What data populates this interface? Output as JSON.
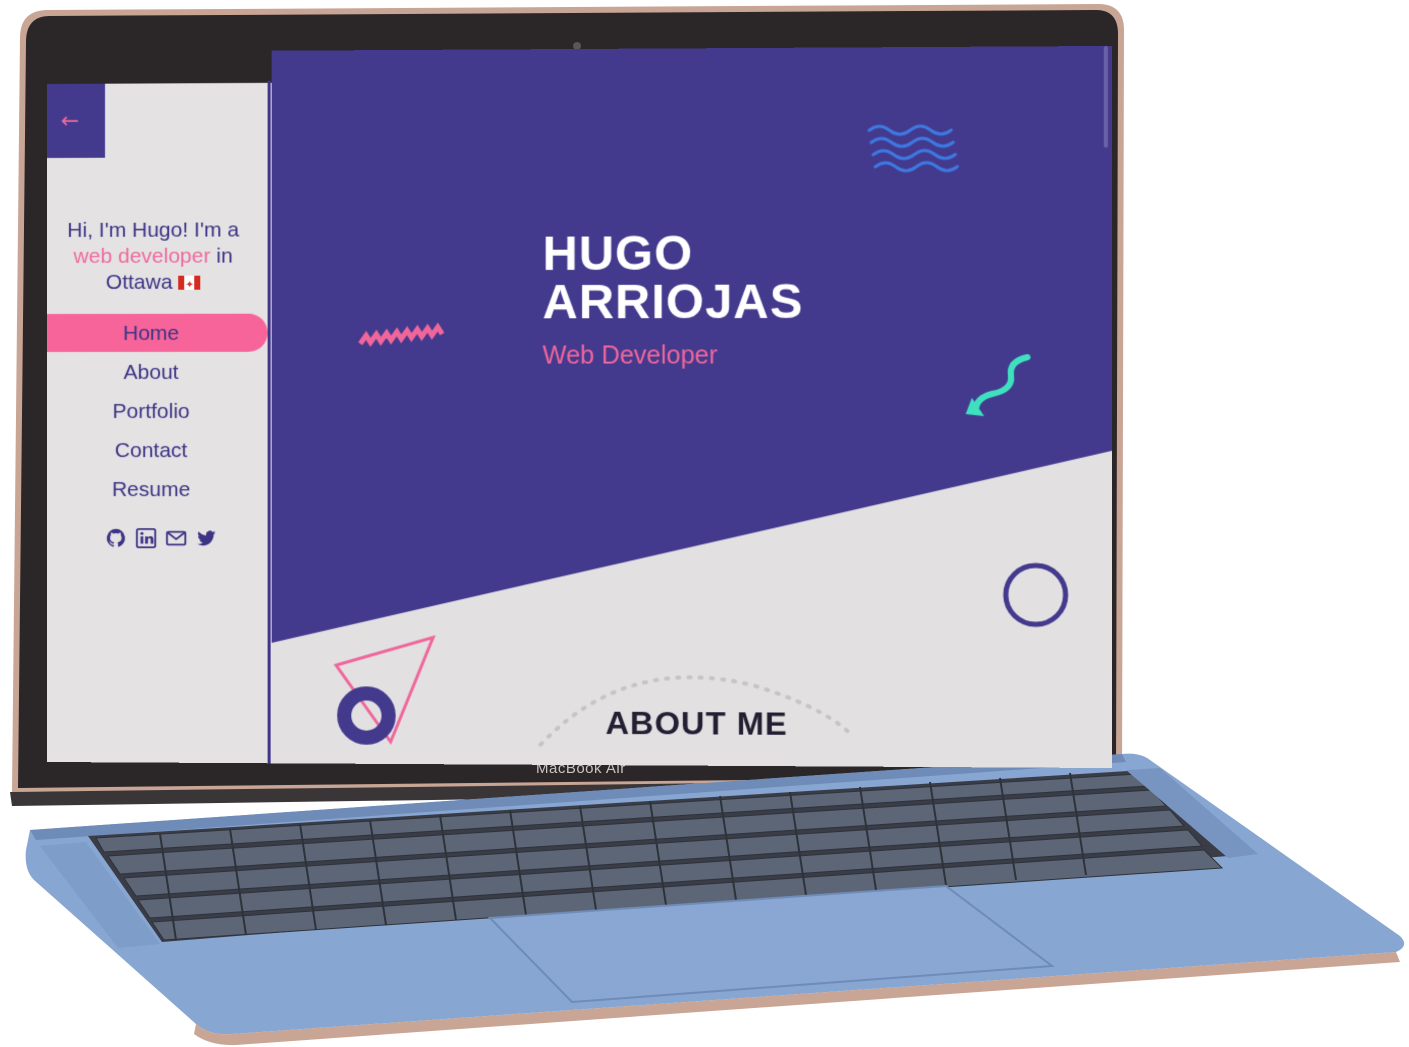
{
  "device": {
    "label": "MacBook Air",
    "body_color": "#88a6d2",
    "bezel_color": "#2a2526"
  },
  "site": {
    "back_arrow": "←",
    "intro": {
      "line1": "Hi, I'm Hugo! I'm a",
      "highlight": "web developer",
      "in": "in",
      "city": "Ottawa"
    },
    "nav": [
      {
        "label": "Home",
        "active": true
      },
      {
        "label": "About",
        "active": false
      },
      {
        "label": "Portfolio",
        "active": false
      },
      {
        "label": "Contact",
        "active": false
      },
      {
        "label": "Resume",
        "active": false
      }
    ],
    "social": [
      "github-icon",
      "linkedin-icon",
      "mail-icon",
      "twitter-icon"
    ],
    "hero": {
      "first_name": "HUGO",
      "last_name": "ARRIOJAS",
      "role": "Web Developer"
    },
    "about_title": "ABOUT ME",
    "colors": {
      "purple": "#433a8e",
      "pink": "#f0669b",
      "teal": "#3fe0c0",
      "blue": "#3d78e0",
      "gray": "#e2e0e1"
    }
  }
}
